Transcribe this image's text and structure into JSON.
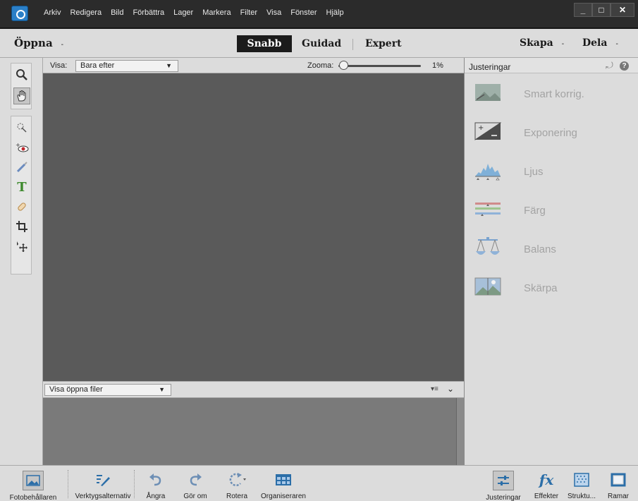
{
  "menu": {
    "items": [
      "Arkiv",
      "Redigera",
      "Bild",
      "Förbättra",
      "Lager",
      "Markera",
      "Filter",
      "Visa",
      "Fönster",
      "Hjälp"
    ]
  },
  "window_buttons": {
    "minimize": "_",
    "maximize": "□",
    "close": "✕"
  },
  "modebar": {
    "open_label": "Öppna",
    "modes": {
      "quick": "Snabb",
      "guided": "Guidad",
      "expert": "Expert"
    },
    "create_label": "Skapa",
    "share_label": "Dela",
    "caret": "-"
  },
  "viewbar": {
    "view_label": "Visa:",
    "view_value": "Bara efter",
    "zoom_label": "Zooma:",
    "zoom_value": "1%"
  },
  "binbar": {
    "select_value": "Visa öppna filer"
  },
  "tools": [
    {
      "name": "zoom-tool-icon"
    },
    {
      "name": "hand-tool-icon"
    },
    {
      "name": "quick-selection-tool-icon"
    },
    {
      "name": "red-eye-tool-icon"
    },
    {
      "name": "whiten-teeth-tool-icon"
    },
    {
      "name": "type-tool-icon"
    },
    {
      "name": "spot-healing-tool-icon"
    },
    {
      "name": "crop-tool-icon"
    },
    {
      "name": "move-tool-icon"
    }
  ],
  "panel": {
    "title": "Justeringar",
    "items": [
      {
        "label": "Smart korrig.",
        "icon": "smart-fix-icon"
      },
      {
        "label": "Exponering",
        "icon": "exposure-icon"
      },
      {
        "label": "Ljus",
        "icon": "lighting-icon"
      },
      {
        "label": "Färg",
        "icon": "color-icon"
      },
      {
        "label": "Balans",
        "icon": "balance-icon"
      },
      {
        "label": "Skärpa",
        "icon": "sharpen-icon"
      }
    ]
  },
  "taskbar": {
    "photo_bin": "Fotobehållaren",
    "tool_options": "Verktygsalternativ",
    "undo": "Ångra",
    "redo": "Gör om",
    "rotate": "Rotera",
    "organizer": "Organiseraren",
    "adjustments": "Justeringar",
    "effects": "Effekter",
    "textures": "Struktu...",
    "frames": "Ramar"
  },
  "colors": {
    "canvas": "#5a5a5a",
    "chrome": "#dcdcdc",
    "menubar": "#2b2b2b",
    "accent": "#2b6ea8"
  }
}
